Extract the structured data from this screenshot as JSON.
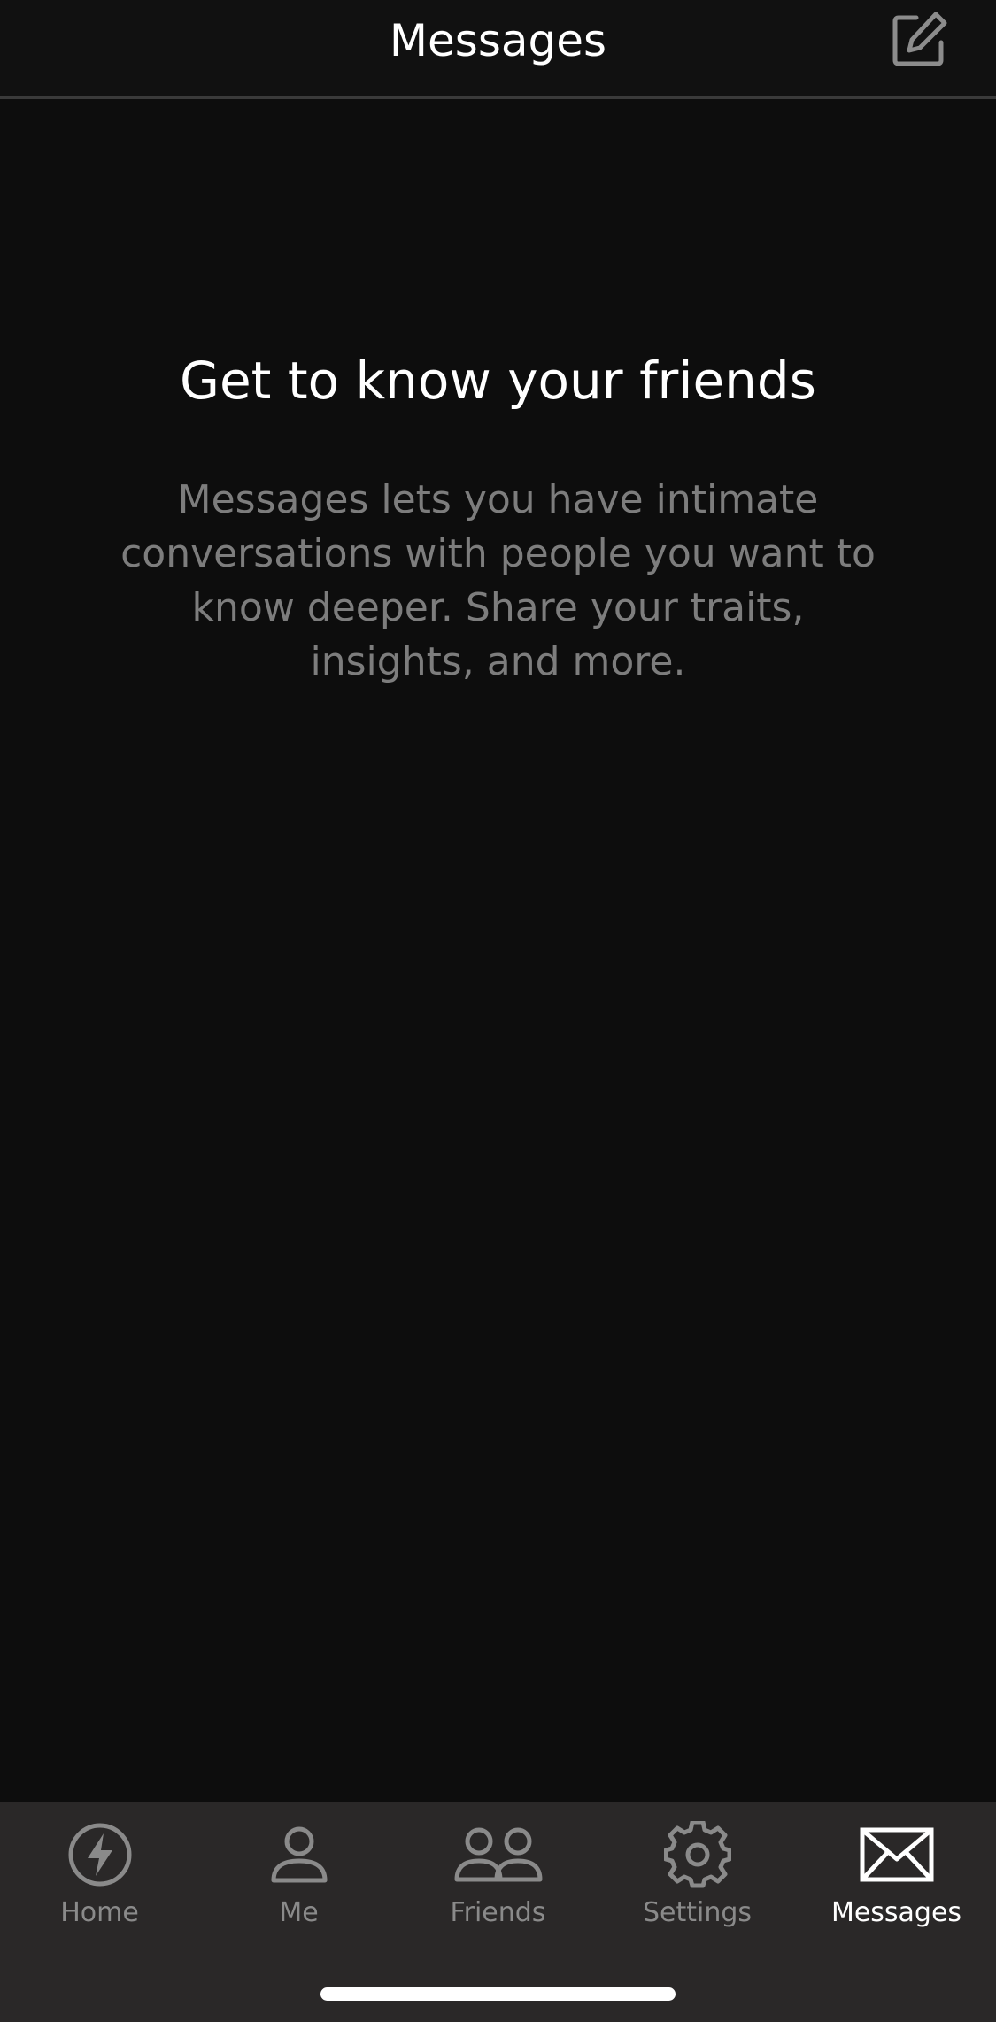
{
  "header": {
    "title": "Messages",
    "compose_icon": "compose-icon"
  },
  "empty_state": {
    "title": "Get to know your friends",
    "description": "Messages lets you have intimate conversations with people you want to know deeper. Share your traits, insights, and more."
  },
  "tabbar": {
    "active": "Messages",
    "items": [
      {
        "label": "Home",
        "icon": "lightning-icon"
      },
      {
        "label": "Me",
        "icon": "person-icon"
      },
      {
        "label": "Friends",
        "icon": "people-icon"
      },
      {
        "label": "Settings",
        "icon": "gear-icon"
      },
      {
        "label": "Messages",
        "icon": "envelope-icon"
      }
    ]
  },
  "colors": {
    "background": "#0d0d0d",
    "header_background": "#111111",
    "tabbar_background": "#2a2828",
    "inactive_tab": "#8a8a8a",
    "active_tab": "#ffffff",
    "description_text": "#7d7d7d"
  }
}
